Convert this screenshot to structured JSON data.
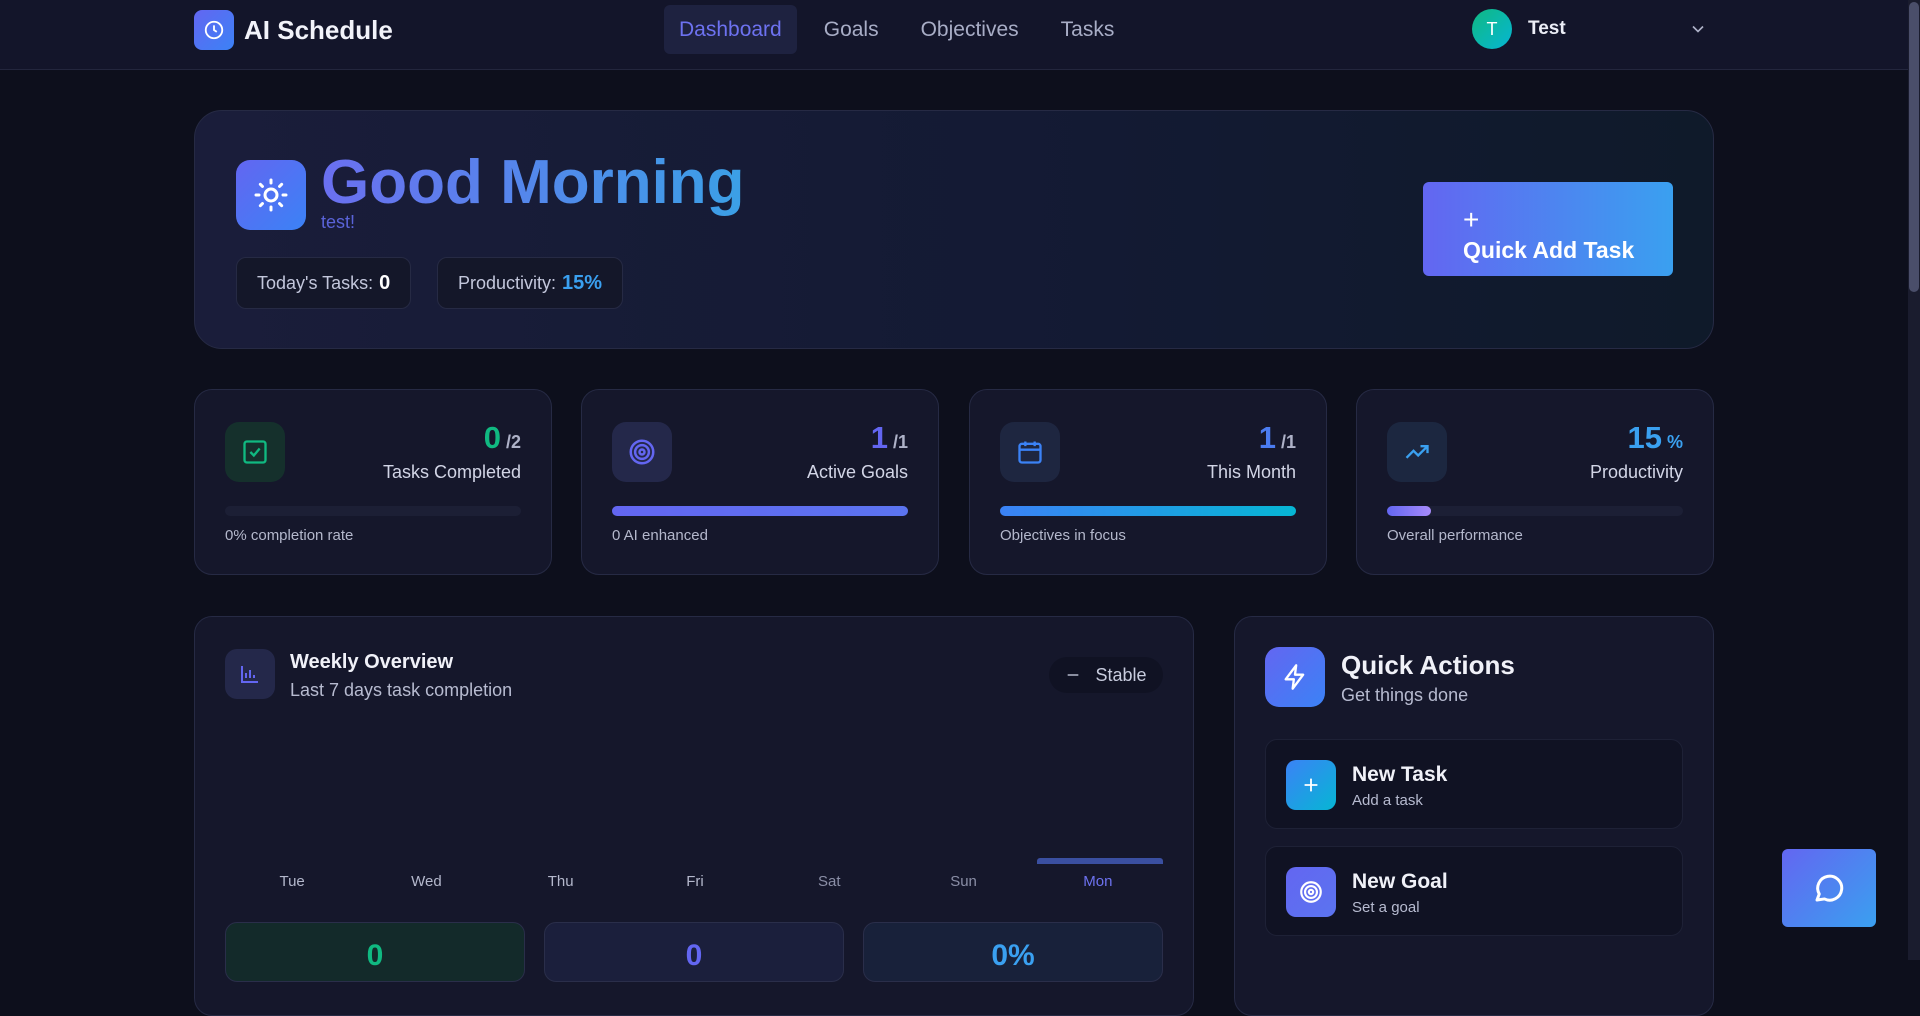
{
  "app": {
    "name": "AI Schedule",
    "icon": "clock-icon"
  },
  "nav": {
    "items": [
      "Dashboard",
      "Goals",
      "Objectives",
      "Tasks"
    ],
    "active": "Dashboard"
  },
  "user": {
    "initial": "T",
    "name": "Test"
  },
  "hero": {
    "title": "Good Morning",
    "subtitle": "test!",
    "todays_tasks_label": "Today's Tasks:",
    "todays_tasks_value": "0",
    "productivity_label": "Productivity:",
    "productivity_value": "15%",
    "quick_add_plus": "+",
    "quick_add_label": "Quick Add Task"
  },
  "stats": [
    {
      "value": "0",
      "denominator": "/2",
      "label": "Tasks Completed",
      "caption": "0% completion rate",
      "progress": 0,
      "color": "#10b981",
      "icon": "check-square-icon"
    },
    {
      "value": "1",
      "denominator": "/1",
      "label": "Active Goals",
      "caption": "0 AI enhanced",
      "progress": 1,
      "color": "#6366f1",
      "icon": "target-icon"
    },
    {
      "value": "1",
      "denominator": "/1",
      "label": "This Month",
      "caption": "Objectives in focus",
      "progress": 1,
      "color": "#3b82f6",
      "icon": "calendar-icon"
    },
    {
      "value": "15",
      "denominator": "%",
      "label": "Productivity",
      "caption": "Overall performance",
      "progress": 0.15,
      "color": "#3aa0f0",
      "icon": "trending-up-icon"
    }
  ],
  "weekly": {
    "title": "Weekly Overview",
    "subtitle": "Last 7 days task completion",
    "trend": "Stable",
    "days": [
      "Tue",
      "Wed",
      "Thu",
      "Fri",
      "Sat",
      "Sun",
      "Mon"
    ],
    "today": "Mon",
    "summary": [
      "0",
      "0",
      "0%"
    ]
  },
  "quick_actions": {
    "title": "Quick Actions",
    "subtitle": "Get things done",
    "items": [
      {
        "title": "New Task",
        "subtitle": "Add a task",
        "icon": "plus-icon"
      },
      {
        "title": "New Goal",
        "subtitle": "Set a goal",
        "icon": "target-icon"
      }
    ]
  },
  "colors": {
    "accent": "#6366f1",
    "accent2": "#3aa0f0",
    "success": "#10b981",
    "bg": "#0d0f1c",
    "card": "#15172b"
  }
}
